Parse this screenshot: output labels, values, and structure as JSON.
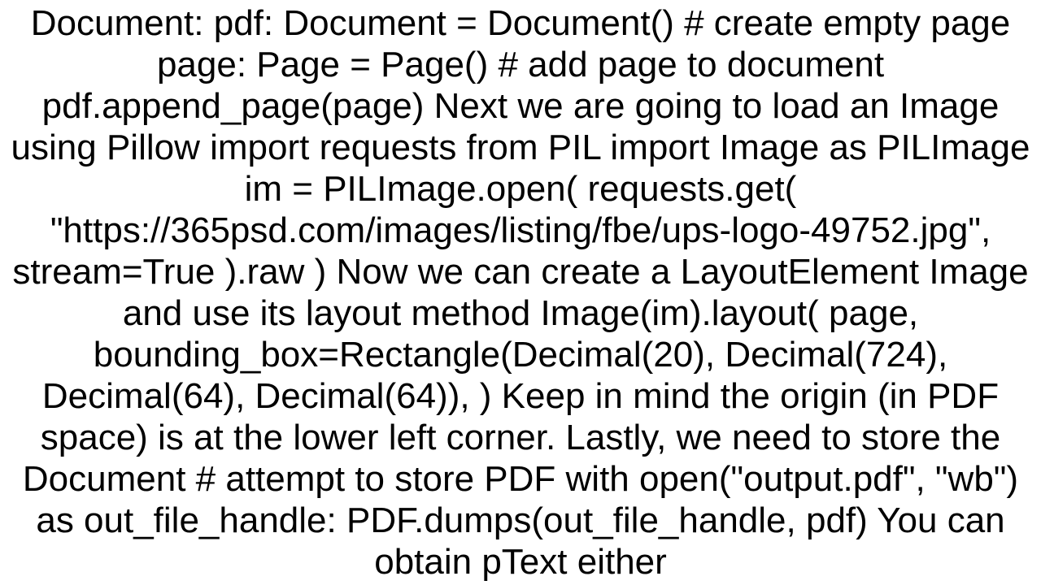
{
  "document": {
    "body_text": "Document: pdf: Document = Document()  # create empty page  page: Page = Page()  # add page to document  pdf.append_page(page)  Next we are going to load an Image using Pillow import requests from PIL import Image as PILImage  im = PILImage.open(         requests.get(   \"https://365psd.com/images/listing/fbe/ups-logo-49752.jpg\", stream=True         ).raw     )  Now we can create a LayoutElement Image and use its layout method  Image(im).layout(         page,         bounding_box=Rectangle(Decimal(20), Decimal(724), Decimal(64), Decimal(64)),     )  Keep in mind the origin (in PDF space) is at the lower left corner. Lastly, we need to store the Document # attempt to store PDF with open(\"output.pdf\", \"wb\") as out_file_handle:         PDF.dumps(out_file_handle, pdf)  You can obtain pText either"
  }
}
